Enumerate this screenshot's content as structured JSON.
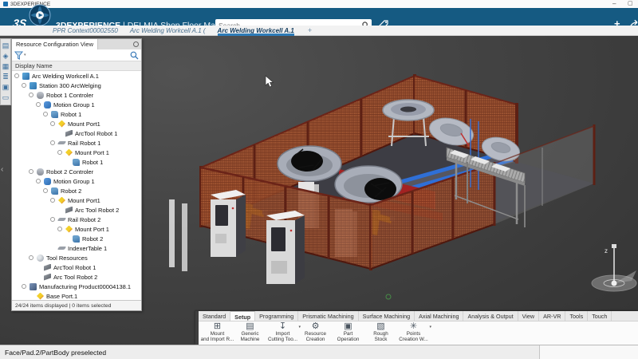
{
  "window": {
    "app_title": "3DEXPERIENCE",
    "minimize": "–",
    "maximize": "▢"
  },
  "header": {
    "logo_text": "3S",
    "brand_bold": "3DEXPERIENCE",
    "brand_divider": "|",
    "brand_app": "DELMIA Shop Floor Machining",
    "search_placeholder": "Search",
    "plus_label": "+"
  },
  "doc_tabs": {
    "items": [
      {
        "label": "PPR Context00002550",
        "active": false
      },
      {
        "label": "Arc Welding Workcell A.1 (",
        "active": false
      },
      {
        "label": "Arc Welding Workcell A.1",
        "active": true
      }
    ],
    "new_tab": "+"
  },
  "left_toolbar": {
    "icons": [
      {
        "name": "tree-view-icon",
        "glyph": "▤"
      },
      {
        "name": "3d-parts-icon",
        "glyph": "◈"
      },
      {
        "name": "grid-view-icon",
        "glyph": "▦"
      },
      {
        "name": "clipboard-icon",
        "glyph": "≣"
      },
      {
        "name": "components-icon",
        "glyph": "▣"
      },
      {
        "name": "panel-toggle-icon",
        "glyph": "▭"
      }
    ]
  },
  "resource_panel": {
    "title": "Resource Configuration View",
    "column_header": "Display Name",
    "footer": "24/24 items displayed | 0 items selected",
    "tree": [
      {
        "label": "Arc Welding Workcell A.1",
        "level": 0,
        "icon": "workcell"
      },
      {
        "label": "Station 300 ArcWelging",
        "level": 1,
        "icon": "station"
      },
      {
        "label": "Robot 1 Controler",
        "level": 2,
        "icon": "controller"
      },
      {
        "label": "Motion Group 1",
        "level": 3,
        "icon": "motion"
      },
      {
        "label": "Robot 1",
        "level": 4,
        "icon": "robot"
      },
      {
        "label": "Mount Port1",
        "level": 5,
        "icon": "port"
      },
      {
        "label": "ArcTool Robot 1",
        "level": 6,
        "icon": "tool"
      },
      {
        "label": "Rail Robot 1",
        "level": 5,
        "icon": "rail"
      },
      {
        "label": "Mount Port 1",
        "level": 6,
        "icon": "port"
      },
      {
        "label": "Robot 1",
        "level": 7,
        "icon": "robot"
      },
      {
        "label": "Robot 2 Controler",
        "level": 2,
        "icon": "controller"
      },
      {
        "label": "Motion Group 1",
        "level": 3,
        "icon": "motion"
      },
      {
        "label": "Robot 2",
        "level": 4,
        "icon": "robot"
      },
      {
        "label": "Mount Port1",
        "level": 5,
        "icon": "port"
      },
      {
        "label": "Arc Tool Robot 2",
        "level": 6,
        "icon": "tool"
      },
      {
        "label": "Rail Robot 2",
        "level": 5,
        "icon": "rail"
      },
      {
        "label": "Mount Port 1",
        "level": 6,
        "icon": "port"
      },
      {
        "label": "Robot 2",
        "level": 7,
        "icon": "robot"
      },
      {
        "label": "IndexerTable 1",
        "level": 5,
        "icon": "rail"
      },
      {
        "label": "Tool Resources",
        "level": 2,
        "icon": "toolres"
      },
      {
        "label": "ArcTool Robot 1",
        "level": 3,
        "icon": "tool"
      },
      {
        "label": "Arc Tool Robot 2",
        "level": 3,
        "icon": "tool"
      },
      {
        "label": "Manufacturing Product00004138.1",
        "level": 1,
        "icon": "product"
      },
      {
        "label": "Base Port.1",
        "level": 2,
        "icon": "port"
      }
    ]
  },
  "viewport": {
    "axis_label": "z"
  },
  "ribbon": {
    "tabs": [
      "Standard",
      "Setup",
      "Programming",
      "Prismatic Machining",
      "Surface Machining",
      "Axial Machining",
      "Analysis & Output",
      "View",
      "AR-VR",
      "Tools",
      "Touch"
    ],
    "active_tab": "Setup",
    "buttons": [
      {
        "line1": "Mount",
        "line2": "and Import R...",
        "icon": "⊞",
        "dropdown": false
      },
      {
        "line1": "Generic",
        "line2": "Machine",
        "icon": "▤",
        "dropdown": false
      },
      {
        "line1": "Import",
        "line2": "Cutting Too...",
        "icon": "↧",
        "dropdown": true
      },
      {
        "line1": "Resource",
        "line2": "Creation",
        "icon": "⚙",
        "dropdown": false
      },
      {
        "line1": "Part",
        "line2": "Operation",
        "icon": "▣",
        "dropdown": false
      },
      {
        "line1": "Rough",
        "line2": "Stock",
        "icon": "▧",
        "dropdown": false
      },
      {
        "line1": "Points",
        "line2": "Creation W...",
        "icon": "✳",
        "dropdown": true
      }
    ]
  },
  "status_bar": {
    "message": "Face/Pad.2/PartBody preselected"
  }
}
